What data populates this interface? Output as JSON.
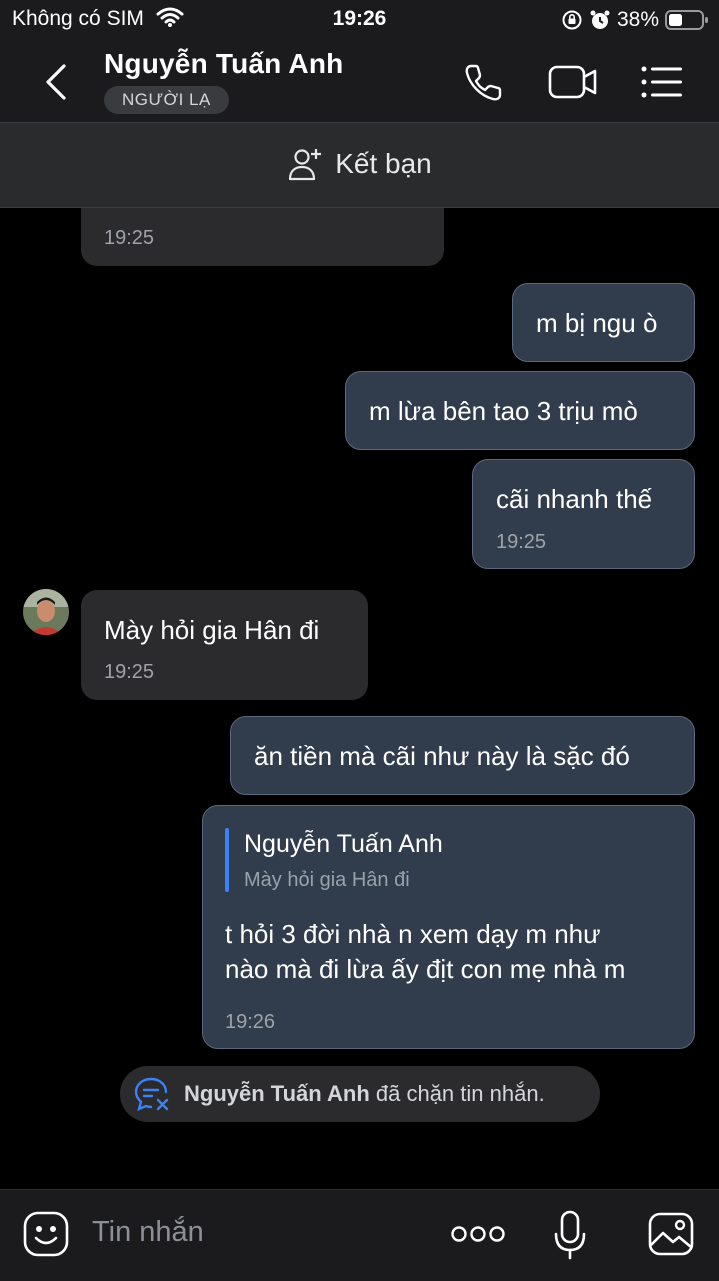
{
  "status_bar": {
    "carrier": "Không có SIM",
    "time": "19:26",
    "battery": "38%"
  },
  "header": {
    "contact_name": "Nguyễn Tuấn Anh",
    "stranger_badge": "NGƯỜI LẠ",
    "add_friend_label": "Kết bạn"
  },
  "messages": {
    "m0": {
      "time": "19:25"
    },
    "m1": {
      "text": "m bị ngu ò"
    },
    "m2": {
      "text": "m lừa bên tao 3 trịu mò"
    },
    "m3": {
      "text": "cãi nhanh thế",
      "time": "19:25"
    },
    "m4": {
      "text": "Mày hỏi gia Hân đi",
      "time": "19:25"
    },
    "m5": {
      "text": "ăn tiền mà cãi như này là sặc đó"
    },
    "m6": {
      "quote_name": "Nguyễn Tuấn Anh",
      "quote_text": "Mày hỏi gia Hân đi",
      "line1": "t hỏi 3 đời nhà n xem dạy m như",
      "line2": "nào mà đi lừa ấy địt con mẹ nhà m",
      "time": "19:26"
    }
  },
  "system_notice": {
    "name": "Nguyễn Tuấn Anh",
    "text": " đã chặn tin nhắn."
  },
  "composer": {
    "placeholder": "Tin nhắn"
  }
}
